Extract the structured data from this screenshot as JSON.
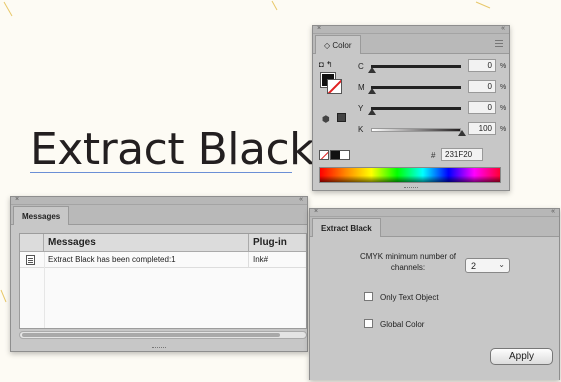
{
  "artboard": {
    "title": "Extract Black"
  },
  "color_panel": {
    "tab": "Color",
    "sliders": [
      {
        "label": "C",
        "value": "0",
        "unit": "%",
        "level": 0
      },
      {
        "label": "M",
        "value": "0",
        "unit": "%",
        "level": 0
      },
      {
        "label": "Y",
        "value": "0",
        "unit": "%",
        "level": 0
      },
      {
        "label": "K",
        "value": "100",
        "unit": "%",
        "level": 1
      }
    ],
    "hash": "#",
    "hex": "231F20",
    "colors": {
      "fill": "#231f20",
      "none": "#ffffff"
    },
    "icons": [
      "fill-stroke-icon",
      "swap-icon",
      "out-of-gamut-cube-icon",
      "none-swatch-icon"
    ]
  },
  "messages_panel": {
    "tab": "Messages",
    "columns": [
      "Messages",
      "Plug-in"
    ],
    "rows": [
      {
        "message": "Extract Black has been completed:1",
        "plugin": "Ink#"
      }
    ]
  },
  "extract_panel": {
    "tab": "Extract Black",
    "min_channels_label": "CMYK minimum number of channels:",
    "min_channels_value": "2",
    "only_text_label": "Only Text Object",
    "only_text_checked": false,
    "global_color_label": "Global Color",
    "global_color_checked": false,
    "apply_label": "Apply"
  }
}
